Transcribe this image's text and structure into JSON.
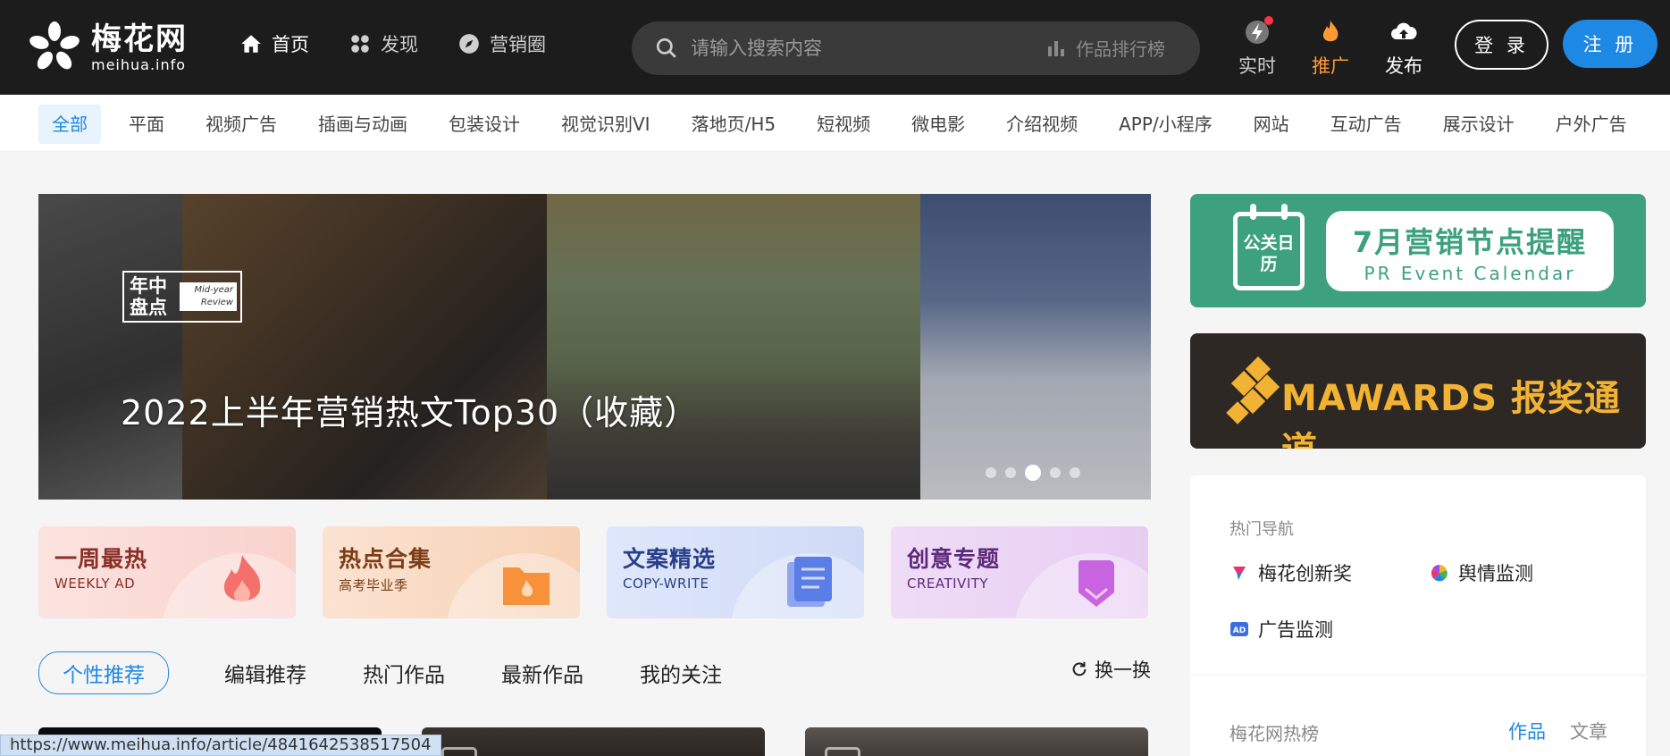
{
  "logo": {
    "cn": "梅花网",
    "en": "meihua.info"
  },
  "nav": [
    {
      "label": "首页",
      "icon": "home-icon"
    },
    {
      "label": "发现",
      "icon": "discover-icon"
    },
    {
      "label": "营销圈",
      "icon": "compass-icon"
    }
  ],
  "search": {
    "placeholder": "请输入搜索内容",
    "rank_label": "作品排行榜"
  },
  "tools": [
    {
      "label": "实时",
      "icon": "flash-icon"
    },
    {
      "label": "推广",
      "icon": "flame-icon"
    },
    {
      "label": "发布",
      "icon": "cloud-upload-icon"
    }
  ],
  "auth": {
    "login": "登 录",
    "register": "注 册"
  },
  "categories": [
    "全部",
    "平面",
    "视频广告",
    "插画与动画",
    "包装设计",
    "视觉识别VI",
    "落地页/H5",
    "短视频",
    "微电影",
    "介绍视频",
    "APP/小程序",
    "网站",
    "互动广告",
    "展示设计",
    "户外广告"
  ],
  "banner": {
    "title": "2022上半年营销热文Top30（收藏）",
    "badge_cn": "年中盘点",
    "badge_en": "Mid-year Review",
    "slides": 5,
    "active_slide": 3
  },
  "ads": {
    "pr": {
      "cal": "公关日历",
      "cn": "7月营销节点提醒",
      "en": "PR Event Calendar"
    },
    "mawards": {
      "text": "MAWARDS 报奖通道"
    }
  },
  "quick_cards": [
    {
      "title": "一周最热",
      "sub": "WEEKLY AD",
      "icon": "fire-icon"
    },
    {
      "title": "热点合集",
      "sub": "高考毕业季",
      "icon": "folder-icon"
    },
    {
      "title": "文案精选",
      "sub": "COPY-WRITE",
      "icon": "document-icon"
    },
    {
      "title": "创意专题",
      "sub": "CREATIVITY",
      "icon": "pencil-icon"
    }
  ],
  "tabs": [
    "个性推荐",
    "编辑推荐",
    "热门作品",
    "最新作品",
    "我的关注"
  ],
  "refresh": "换一换",
  "sidebar": {
    "title": "热门导航",
    "links": [
      "梅花创新奖",
      "舆情监测",
      "广告监测"
    ],
    "hot_title": "梅花网热榜",
    "hot_tabs": [
      "作品",
      "文章"
    ]
  },
  "status_url": "https://www.meihua.info/article/4841642538517504",
  "colors": {
    "accent": "#1e88e5",
    "topbar": "#1c1c1c",
    "promo": "#ff9933",
    "pr_green": "#3da07f",
    "mawards_gold": "#f2b233"
  }
}
